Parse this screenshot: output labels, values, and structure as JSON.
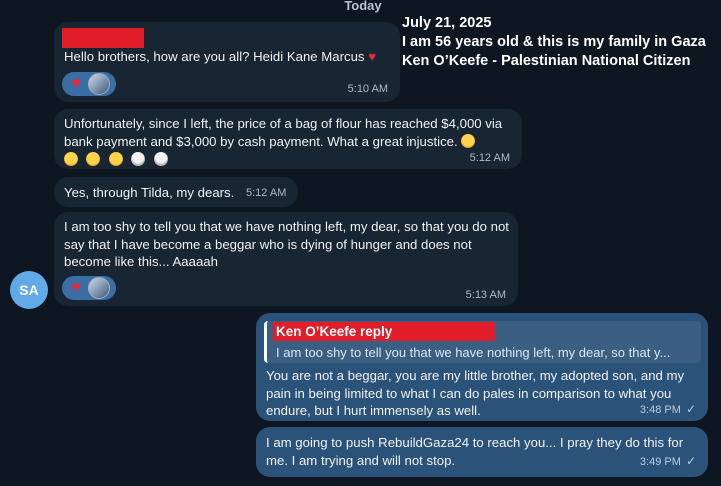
{
  "date_separator": "Today",
  "overlay": {
    "line1": "July 21, 2025",
    "line2": "I am 56 years old & this is my family in Gaza",
    "line3": "Ken O’Keefe - Palestinian National Citizen"
  },
  "messages": [
    {
      "text": "Hello brothers, how are you all? Heidi Kane Marcus",
      "trailing_emoji": "broken-heart",
      "time": "5:10 AM",
      "reactions": [
        "heart",
        "avatar"
      ]
    },
    {
      "text": "Unfortunately, since I left, the price of a bag of flour has reached $4,000 via bank payment and $3,000 by cash payment. What a great injustice.",
      "emojis": [
        "sleepy-face",
        "crying-face",
        "crying-face",
        "crying-face",
        "skull-crossbones",
        "skull"
      ],
      "time": "5:12 AM"
    },
    {
      "text": "Yes, through Tilda, my dears.",
      "time": "5:12 AM"
    },
    {
      "text": "I am too shy to tell you that we have nothing left, my dear, so that you do not say that I have become a beggar who is dying of hunger and does not become like this... Aaaaah",
      "time": "5:13 AM",
      "reactions": [
        "heart",
        "avatar"
      ]
    }
  ],
  "sender_avatar": "SA",
  "outgoing": [
    {
      "reply_label": "Ken O’Keefe reply",
      "reply_quote": "I am too shy to tell you that we have nothing left, my dear, so that y...",
      "text": "You are not a beggar, you are my little brother, my adopted son, and my pain in being limited to what I can do pales in comparison to what you endure, but I hurt immensely as well.",
      "time": "3:48 PM",
      "status": "✓"
    },
    {
      "text": "I am going to push RebuildGaza24 to reach you... I pray they do this for me.  I am trying and will not stop.",
      "time": "3:49 PM",
      "status": "✓"
    }
  ],
  "colors": {
    "background": "#0e1621",
    "incoming_bubble": "#182533",
    "outgoing_bubble": "#2b5278",
    "avatar": "#62a9e7",
    "redaction": "#e11d2a"
  }
}
